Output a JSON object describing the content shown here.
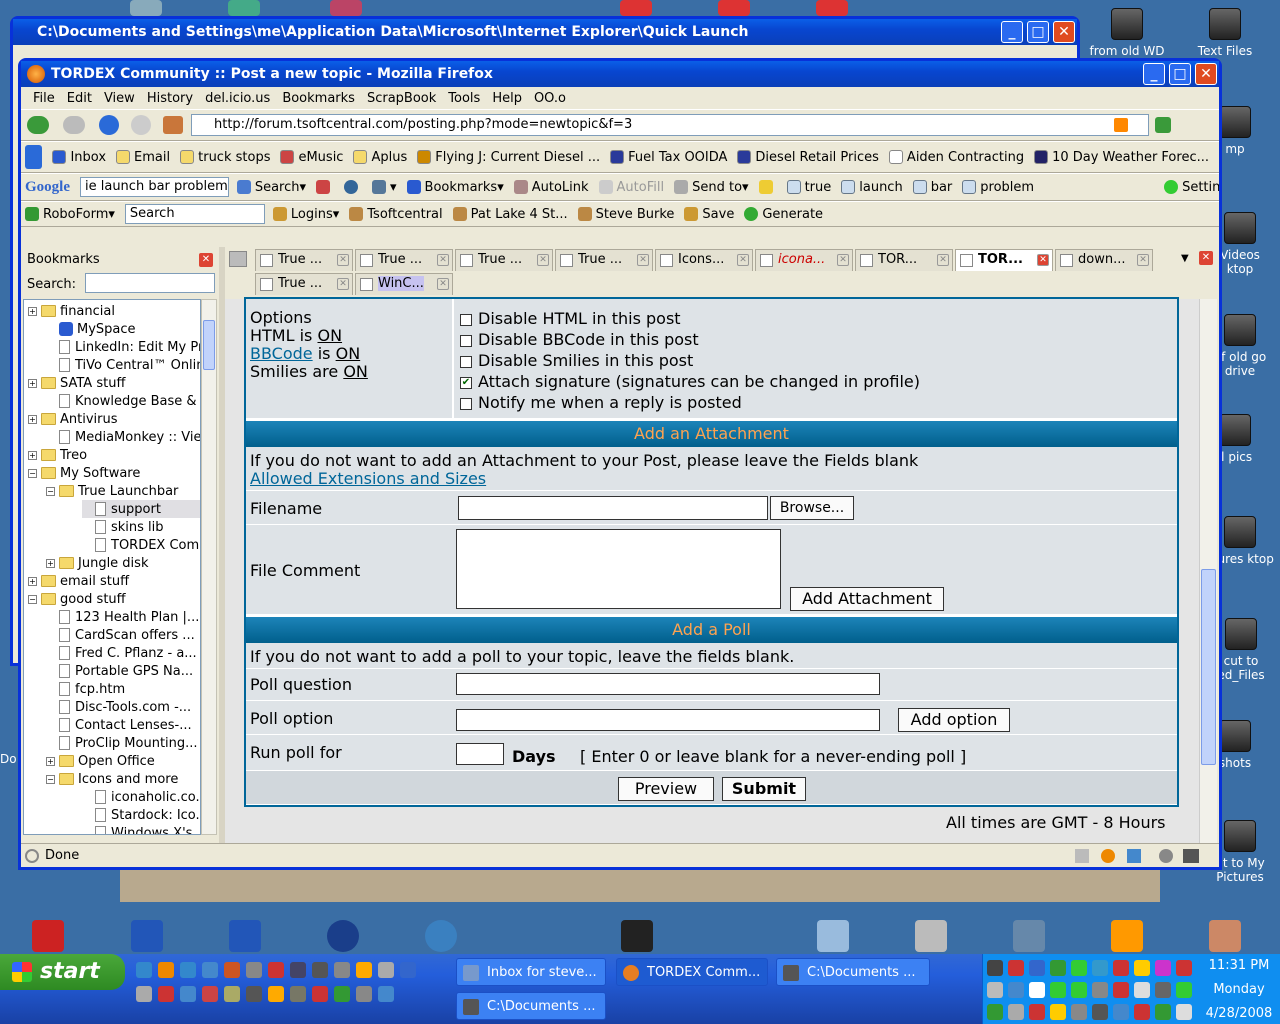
{
  "desktop": {
    "icons": [
      {
        "label": "from old WD"
      },
      {
        "label": "Text Files"
      },
      {
        "label": "mp"
      },
      {
        "label": "Videos ktop"
      },
      {
        "label": "of old go drive"
      },
      {
        "label": "il pics"
      },
      {
        "label": "ctures ktop"
      },
      {
        "label": "cut to ed_Files"
      },
      {
        "label": "shots"
      },
      {
        "label": "ut to My Pictures"
      },
      {
        "label": "Do"
      }
    ]
  },
  "explorer_window": {
    "title": "C:\\Documents and Settings\\me\\Application Data\\Microsoft\\Internet Explorer\\Quick Launch"
  },
  "firefox": {
    "title": "TORDEX Community :: Post a new topic - Mozilla Firefox",
    "menu": [
      "File",
      "Edit",
      "View",
      "History",
      "del.icio.us",
      "Bookmarks",
      "ScrapBook",
      "Tools",
      "Help",
      "OO.o"
    ],
    "url": "http://forum.tsoftcentral.com/posting.php?mode=newtopic&f=3",
    "bookmarks_bar": [
      "Inbox",
      "Email",
      "truck stops",
      "eMusic",
      "Aplus",
      "Flying J: Current Diesel ...",
      "Fuel Tax OOIDA",
      "Diesel Retail Prices",
      "Aiden Contracting",
      "10 Day Weather Forec..."
    ],
    "google_bar": {
      "brand": "Google",
      "query": "ie launch bar problem",
      "search": "Search",
      "bookmarks": "Bookmarks",
      "autolink": "AutoLink",
      "autofill": "AutoFill",
      "sendto": "Send to",
      "terms": [
        "true",
        "launch",
        "bar",
        "problem"
      ],
      "settings": "Settings"
    },
    "roboform_bar": {
      "roboform": "RoboForm",
      "search_placeholder": "Search",
      "logins": "Logins",
      "items": [
        "Tsoftcentral",
        "Pat Lake 4 St...",
        "Steve Burke"
      ],
      "save": "Save",
      "generate": "Generate"
    },
    "tabs_row1": [
      "True ...",
      "True ...",
      "True ...",
      "True ...",
      "Icons...",
      "icona...",
      "TOR...",
      "TOR...",
      "down..."
    ],
    "tabs_row2": [
      "True ...",
      "WinC..."
    ],
    "status": "Done"
  },
  "sidebar": {
    "title": "Bookmarks",
    "search_label": "Search:",
    "items": [
      {
        "label": "financial"
      },
      {
        "label": "MySpace"
      },
      {
        "label": "LinkedIn: Edit My Pr..."
      },
      {
        "label": "TiVo Central™ Online"
      },
      {
        "label": "SATA stuff"
      },
      {
        "label": "Knowledge Base & F..."
      },
      {
        "label": "Antivirus"
      },
      {
        "label": "MediaMonkey :: Vie..."
      },
      {
        "label": "Treo"
      },
      {
        "label": "My Software"
      },
      {
        "label": "True Launchbar"
      },
      {
        "label": "support"
      },
      {
        "label": "skins lib"
      },
      {
        "label": "TORDEX Com..."
      },
      {
        "label": "Jungle disk"
      },
      {
        "label": "email stuff"
      },
      {
        "label": "good stuff"
      },
      {
        "label": "123 Health Plan |..."
      },
      {
        "label": "CardScan offers ..."
      },
      {
        "label": "Fred C. Pflanz - a..."
      },
      {
        "label": "Portable GPS Na..."
      },
      {
        "label": "fcp.htm"
      },
      {
        "label": "Disc-Tools.com -..."
      },
      {
        "label": "Contact Lenses-..."
      },
      {
        "label": "ProClip Mounting..."
      },
      {
        "label": "Open Office"
      },
      {
        "label": "Icons and more"
      },
      {
        "label": "iconaholic.co..."
      },
      {
        "label": "Stardock: Ico..."
      },
      {
        "label": "Windows X's ..."
      }
    ]
  },
  "forum": {
    "options_label": "Options",
    "html_is": "HTML is",
    "on1": "ON",
    "bbcode": "BBCode",
    "is": "is",
    "on2": "ON",
    "smilies_are": "Smilies are",
    "on3": "ON",
    "checkboxes": [
      {
        "label": "Disable HTML in this post",
        "checked": false
      },
      {
        "label": "Disable BBCode in this post",
        "checked": false
      },
      {
        "label": "Disable Smilies in this post",
        "checked": false
      },
      {
        "label": "Attach signature (signatures can be changed in profile)",
        "checked": true
      },
      {
        "label": "Notify me when a reply is posted",
        "checked": false
      }
    ],
    "attachment_header": "Add an Attachment",
    "attachment_note": "If you do not want to add an Attachment to your Post, please leave the Fields blank",
    "allowed_link": "Allowed Extensions and Sizes",
    "filename_label": "Filename",
    "browse": "Browse...",
    "file_comment_label": "File Comment",
    "add_attachment": "Add Attachment",
    "poll_header": "Add a Poll",
    "poll_note": "If you do not want to add a poll to your topic, leave the fields blank.",
    "poll_question": "Poll question",
    "poll_option": "Poll option",
    "add_option": "Add option",
    "run_poll_for": "Run poll for",
    "days": "Days",
    "days_hint": "[ Enter 0 or leave blank for a never-ending poll ]",
    "preview": "Preview",
    "submit": "Submit",
    "timezone": "All times are GMT - 8 Hours"
  },
  "taskbar": {
    "start": "start",
    "buttons": [
      "Inbox for steve...",
      "TORDEX Comm...",
      "C:\\Documents ...",
      "C:\\Documents ..."
    ],
    "time": "11:31 PM",
    "day": "Monday",
    "date": "4/28/2008"
  },
  "colors": {
    "forum_header": "#006699",
    "header_text": "#ffa34f",
    "row_bg": "#dee3e7",
    "xp_blue": "#0831d9"
  }
}
